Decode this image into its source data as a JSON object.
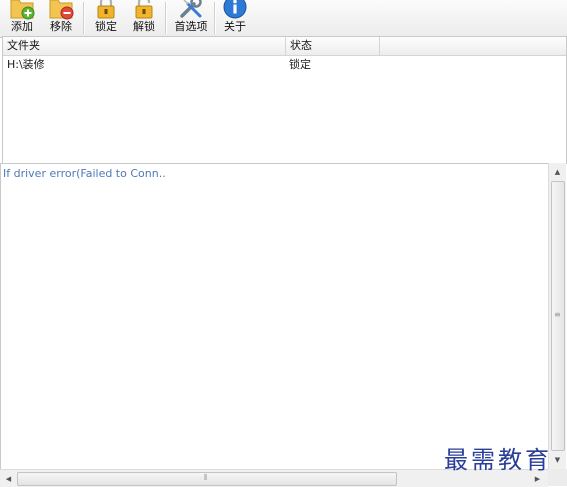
{
  "toolbar": {
    "add_label": "添加",
    "remove_label": "移除",
    "lock_label": "锁定",
    "unlock_label": "解锁",
    "preferences_label": "首选项",
    "about_label": "关于"
  },
  "table": {
    "columns": [
      "文件夹",
      "状态"
    ],
    "rows": [
      {
        "folder": "H:\\装修",
        "status": "锁定"
      }
    ]
  },
  "log": {
    "lines": [
      "If driver error(Failed to Conn.."
    ]
  },
  "watermark": "最需教育",
  "colors": {
    "log_text": "#4f78b8",
    "watermark": "#2a3d9a",
    "toolbar_bg": "#f2f2f2"
  },
  "icons": {
    "add": "folder-add-icon",
    "remove": "folder-remove-icon",
    "lock": "padlock-locked-icon",
    "unlock": "padlock-unlocked-icon",
    "preferences": "wrench-screwdriver-icon",
    "about": "info-icon"
  }
}
